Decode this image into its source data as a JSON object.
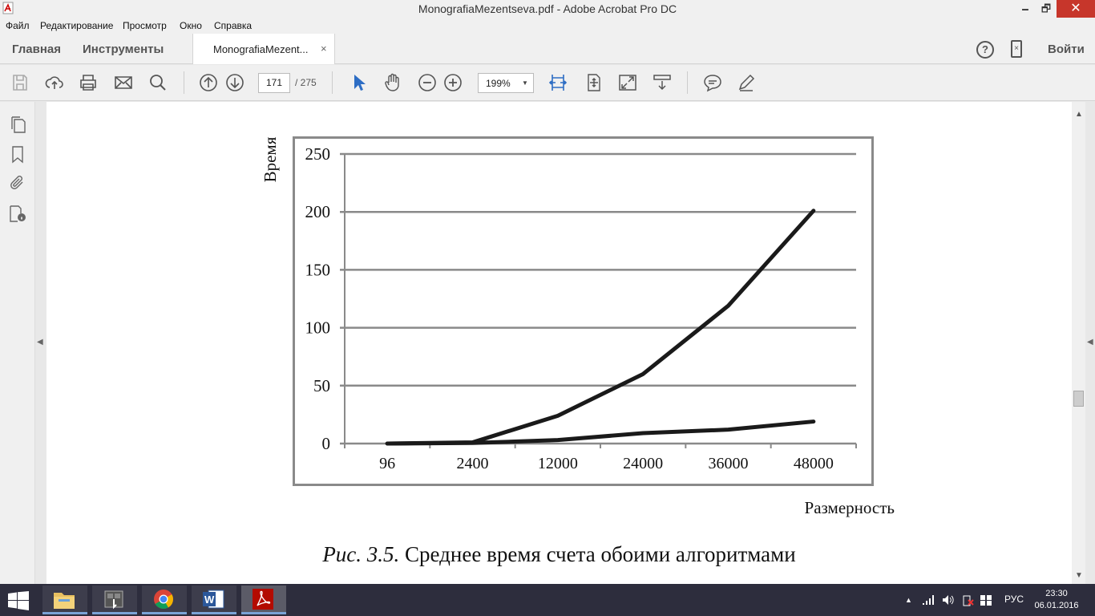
{
  "window": {
    "title": "MonografiaMezentseva.pdf - Adobe Acrobat Pro DC",
    "minimize": "🗕",
    "maximize": "🗗",
    "close": "✕"
  },
  "menu": [
    "Файл",
    "Редактирование",
    "Просмотр",
    "Окно",
    "Справка"
  ],
  "tabs": {
    "home": "Главная",
    "tools": "Инструменты",
    "document": "MonografiaMezent...",
    "close": "×"
  },
  "account": {
    "help": "?",
    "sign_in": "Войти"
  },
  "toolbar": {
    "page_current": "171",
    "page_total": "/ 275",
    "zoom": "199%"
  },
  "icons": {
    "toolbar": [
      "save-icon",
      "upload-icon",
      "print-icon",
      "email-icon",
      "search-icon",
      "prev-page-icon",
      "next-page-icon",
      "select-arrow-icon",
      "hand-icon",
      "zoom-out-icon",
      "zoom-in-icon",
      "fit-width-icon",
      "fit-page-icon",
      "fullscreen-icon",
      "scroll-mode-icon",
      "comment-icon",
      "sign-icon"
    ],
    "left_panel": [
      "pages-icon",
      "bookmark-icon",
      "attachment-icon",
      "document-info-icon"
    ]
  },
  "document": {
    "caption_fig": "Рис. 3.5.",
    "caption_text": " Среднее время счета обоими алгоритмами"
  },
  "chart_data": {
    "type": "line",
    "categories": [
      "96",
      "2400",
      "12000",
      "24000",
      "36000",
      "48000"
    ],
    "series": [
      {
        "values": [
          0,
          1,
          24,
          60,
          119,
          201
        ]
      },
      {
        "values": [
          0,
          0.5,
          3,
          9,
          12,
          19
        ]
      }
    ],
    "y_ticks": [
      "0",
      "50",
      "100",
      "150",
      "200",
      "250"
    ],
    "ylim": [
      0,
      250
    ],
    "xlabel": "Размерность",
    "ylabel": "Время",
    "grid": true,
    "line_color": "#1a1a1a"
  },
  "taskbar": {
    "apps": [
      "file-explorer-icon",
      "media-app-icon",
      "chrome-icon",
      "word-icon",
      "acrobat-icon"
    ],
    "language": "РУС",
    "time": "23:30",
    "date": "06.01.2016"
  }
}
